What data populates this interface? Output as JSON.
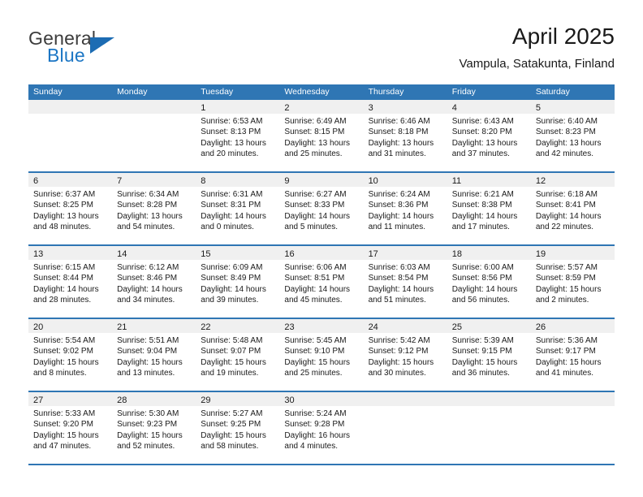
{
  "brand": {
    "name_top": "General",
    "name_bottom": "Blue",
    "accent_color": "#1c6cb3"
  },
  "header": {
    "title": "April 2025",
    "location": "Vampula, Satakunta, Finland"
  },
  "theme": {
    "header_blue": "#2f76b4",
    "band_gray": "#f0f0f0",
    "text": "#1a1a1a"
  },
  "weekday_headers": [
    "Sunday",
    "Monday",
    "Tuesday",
    "Wednesday",
    "Thursday",
    "Friday",
    "Saturday"
  ],
  "weeks": [
    [
      {
        "day": "",
        "sunrise": "",
        "sunset": "",
        "daylight_line1": "",
        "daylight_line2": ""
      },
      {
        "day": "",
        "sunrise": "",
        "sunset": "",
        "daylight_line1": "",
        "daylight_line2": ""
      },
      {
        "day": "1",
        "sunrise": "Sunrise: 6:53 AM",
        "sunset": "Sunset: 8:13 PM",
        "daylight_line1": "Daylight: 13 hours",
        "daylight_line2": "and 20 minutes."
      },
      {
        "day": "2",
        "sunrise": "Sunrise: 6:49 AM",
        "sunset": "Sunset: 8:15 PM",
        "daylight_line1": "Daylight: 13 hours",
        "daylight_line2": "and 25 minutes."
      },
      {
        "day": "3",
        "sunrise": "Sunrise: 6:46 AM",
        "sunset": "Sunset: 8:18 PM",
        "daylight_line1": "Daylight: 13 hours",
        "daylight_line2": "and 31 minutes."
      },
      {
        "day": "4",
        "sunrise": "Sunrise: 6:43 AM",
        "sunset": "Sunset: 8:20 PM",
        "daylight_line1": "Daylight: 13 hours",
        "daylight_line2": "and 37 minutes."
      },
      {
        "day": "5",
        "sunrise": "Sunrise: 6:40 AM",
        "sunset": "Sunset: 8:23 PM",
        "daylight_line1": "Daylight: 13 hours",
        "daylight_line2": "and 42 minutes."
      }
    ],
    [
      {
        "day": "6",
        "sunrise": "Sunrise: 6:37 AM",
        "sunset": "Sunset: 8:25 PM",
        "daylight_line1": "Daylight: 13 hours",
        "daylight_line2": "and 48 minutes."
      },
      {
        "day": "7",
        "sunrise": "Sunrise: 6:34 AM",
        "sunset": "Sunset: 8:28 PM",
        "daylight_line1": "Daylight: 13 hours",
        "daylight_line2": "and 54 minutes."
      },
      {
        "day": "8",
        "sunrise": "Sunrise: 6:31 AM",
        "sunset": "Sunset: 8:31 PM",
        "daylight_line1": "Daylight: 14 hours",
        "daylight_line2": "and 0 minutes."
      },
      {
        "day": "9",
        "sunrise": "Sunrise: 6:27 AM",
        "sunset": "Sunset: 8:33 PM",
        "daylight_line1": "Daylight: 14 hours",
        "daylight_line2": "and 5 minutes."
      },
      {
        "day": "10",
        "sunrise": "Sunrise: 6:24 AM",
        "sunset": "Sunset: 8:36 PM",
        "daylight_line1": "Daylight: 14 hours",
        "daylight_line2": "and 11 minutes."
      },
      {
        "day": "11",
        "sunrise": "Sunrise: 6:21 AM",
        "sunset": "Sunset: 8:38 PM",
        "daylight_line1": "Daylight: 14 hours",
        "daylight_line2": "and 17 minutes."
      },
      {
        "day": "12",
        "sunrise": "Sunrise: 6:18 AM",
        "sunset": "Sunset: 8:41 PM",
        "daylight_line1": "Daylight: 14 hours",
        "daylight_line2": "and 22 minutes."
      }
    ],
    [
      {
        "day": "13",
        "sunrise": "Sunrise: 6:15 AM",
        "sunset": "Sunset: 8:44 PM",
        "daylight_line1": "Daylight: 14 hours",
        "daylight_line2": "and 28 minutes."
      },
      {
        "day": "14",
        "sunrise": "Sunrise: 6:12 AM",
        "sunset": "Sunset: 8:46 PM",
        "daylight_line1": "Daylight: 14 hours",
        "daylight_line2": "and 34 minutes."
      },
      {
        "day": "15",
        "sunrise": "Sunrise: 6:09 AM",
        "sunset": "Sunset: 8:49 PM",
        "daylight_line1": "Daylight: 14 hours",
        "daylight_line2": "and 39 minutes."
      },
      {
        "day": "16",
        "sunrise": "Sunrise: 6:06 AM",
        "sunset": "Sunset: 8:51 PM",
        "daylight_line1": "Daylight: 14 hours",
        "daylight_line2": "and 45 minutes."
      },
      {
        "day": "17",
        "sunrise": "Sunrise: 6:03 AM",
        "sunset": "Sunset: 8:54 PM",
        "daylight_line1": "Daylight: 14 hours",
        "daylight_line2": "and 51 minutes."
      },
      {
        "day": "18",
        "sunrise": "Sunrise: 6:00 AM",
        "sunset": "Sunset: 8:56 PM",
        "daylight_line1": "Daylight: 14 hours",
        "daylight_line2": "and 56 minutes."
      },
      {
        "day": "19",
        "sunrise": "Sunrise: 5:57 AM",
        "sunset": "Sunset: 8:59 PM",
        "daylight_line1": "Daylight: 15 hours",
        "daylight_line2": "and 2 minutes."
      }
    ],
    [
      {
        "day": "20",
        "sunrise": "Sunrise: 5:54 AM",
        "sunset": "Sunset: 9:02 PM",
        "daylight_line1": "Daylight: 15 hours",
        "daylight_line2": "and 8 minutes."
      },
      {
        "day": "21",
        "sunrise": "Sunrise: 5:51 AM",
        "sunset": "Sunset: 9:04 PM",
        "daylight_line1": "Daylight: 15 hours",
        "daylight_line2": "and 13 minutes."
      },
      {
        "day": "22",
        "sunrise": "Sunrise: 5:48 AM",
        "sunset": "Sunset: 9:07 PM",
        "daylight_line1": "Daylight: 15 hours",
        "daylight_line2": "and 19 minutes."
      },
      {
        "day": "23",
        "sunrise": "Sunrise: 5:45 AM",
        "sunset": "Sunset: 9:10 PM",
        "daylight_line1": "Daylight: 15 hours",
        "daylight_line2": "and 25 minutes."
      },
      {
        "day": "24",
        "sunrise": "Sunrise: 5:42 AM",
        "sunset": "Sunset: 9:12 PM",
        "daylight_line1": "Daylight: 15 hours",
        "daylight_line2": "and 30 minutes."
      },
      {
        "day": "25",
        "sunrise": "Sunrise: 5:39 AM",
        "sunset": "Sunset: 9:15 PM",
        "daylight_line1": "Daylight: 15 hours",
        "daylight_line2": "and 36 minutes."
      },
      {
        "day": "26",
        "sunrise": "Sunrise: 5:36 AM",
        "sunset": "Sunset: 9:17 PM",
        "daylight_line1": "Daylight: 15 hours",
        "daylight_line2": "and 41 minutes."
      }
    ],
    [
      {
        "day": "27",
        "sunrise": "Sunrise: 5:33 AM",
        "sunset": "Sunset: 9:20 PM",
        "daylight_line1": "Daylight: 15 hours",
        "daylight_line2": "and 47 minutes."
      },
      {
        "day": "28",
        "sunrise": "Sunrise: 5:30 AM",
        "sunset": "Sunset: 9:23 PM",
        "daylight_line1": "Daylight: 15 hours",
        "daylight_line2": "and 52 minutes."
      },
      {
        "day": "29",
        "sunrise": "Sunrise: 5:27 AM",
        "sunset": "Sunset: 9:25 PM",
        "daylight_line1": "Daylight: 15 hours",
        "daylight_line2": "and 58 minutes."
      },
      {
        "day": "30",
        "sunrise": "Sunrise: 5:24 AM",
        "sunset": "Sunset: 9:28 PM",
        "daylight_line1": "Daylight: 16 hours",
        "daylight_line2": "and 4 minutes."
      },
      {
        "day": "",
        "sunrise": "",
        "sunset": "",
        "daylight_line1": "",
        "daylight_line2": ""
      },
      {
        "day": "",
        "sunrise": "",
        "sunset": "",
        "daylight_line1": "",
        "daylight_line2": ""
      },
      {
        "day": "",
        "sunrise": "",
        "sunset": "",
        "daylight_line1": "",
        "daylight_line2": ""
      }
    ]
  ]
}
